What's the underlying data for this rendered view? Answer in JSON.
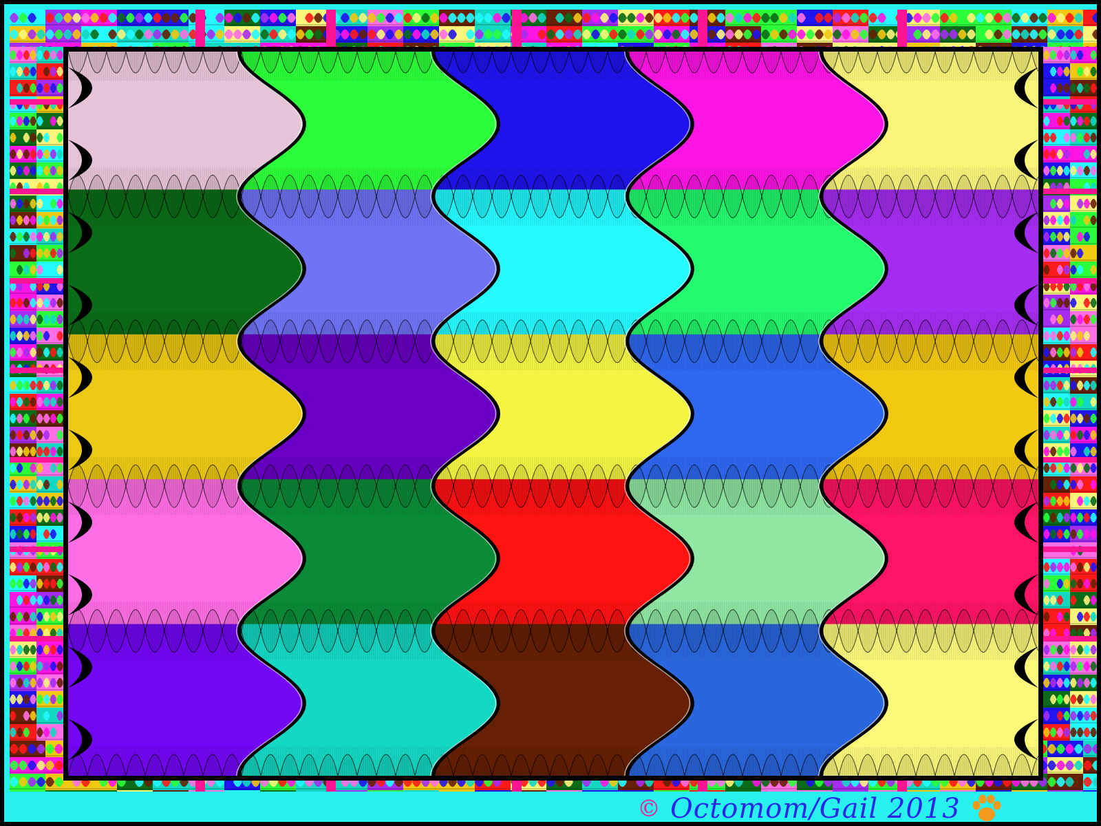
{
  "artwork": {
    "copyright_symbol": "©",
    "credit": "Octomom/Gail 2013",
    "logo_icon": "paw-print-icon"
  },
  "colors": {
    "background": "#27f0ee",
    "frame": "#000000",
    "credit_text": "#2a28e6",
    "copyright_symbol": "#ff1493",
    "paw": "#f39a1c"
  },
  "mosaic": {
    "columns": 5,
    "rows": 5,
    "cell_colors": [
      [
        "#e7c3d7",
        "#2bff3a",
        "#2014ee",
        "#ff14e6",
        "#fbf57a"
      ],
      [
        "#0b6c18",
        "#7073f6",
        "#23fbff",
        "#21fb6d",
        "#a52cf1"
      ],
      [
        "#ecc912",
        "#6a00c6",
        "#f4f442",
        "#2e68f1",
        "#f2c811"
      ],
      [
        "#ff6ee4",
        "#0a8b37",
        "#ff1212",
        "#8fe7a3",
        "#ff1366"
      ],
      [
        "#7307f5",
        "#13d8c2",
        "#662003",
        "#2a67de",
        "#fbf87a"
      ]
    ],
    "stripe_pattern": "vertical hatched lens chains between rows"
  },
  "border_palette": [
    "#ff1a1a",
    "#2bff3a",
    "#2014ee",
    "#ff14e6",
    "#fbf57a",
    "#23fbff",
    "#a52cf1",
    "#f2c811",
    "#0b6c18",
    "#ff6ee4",
    "#13d8c2",
    "#662003"
  ]
}
